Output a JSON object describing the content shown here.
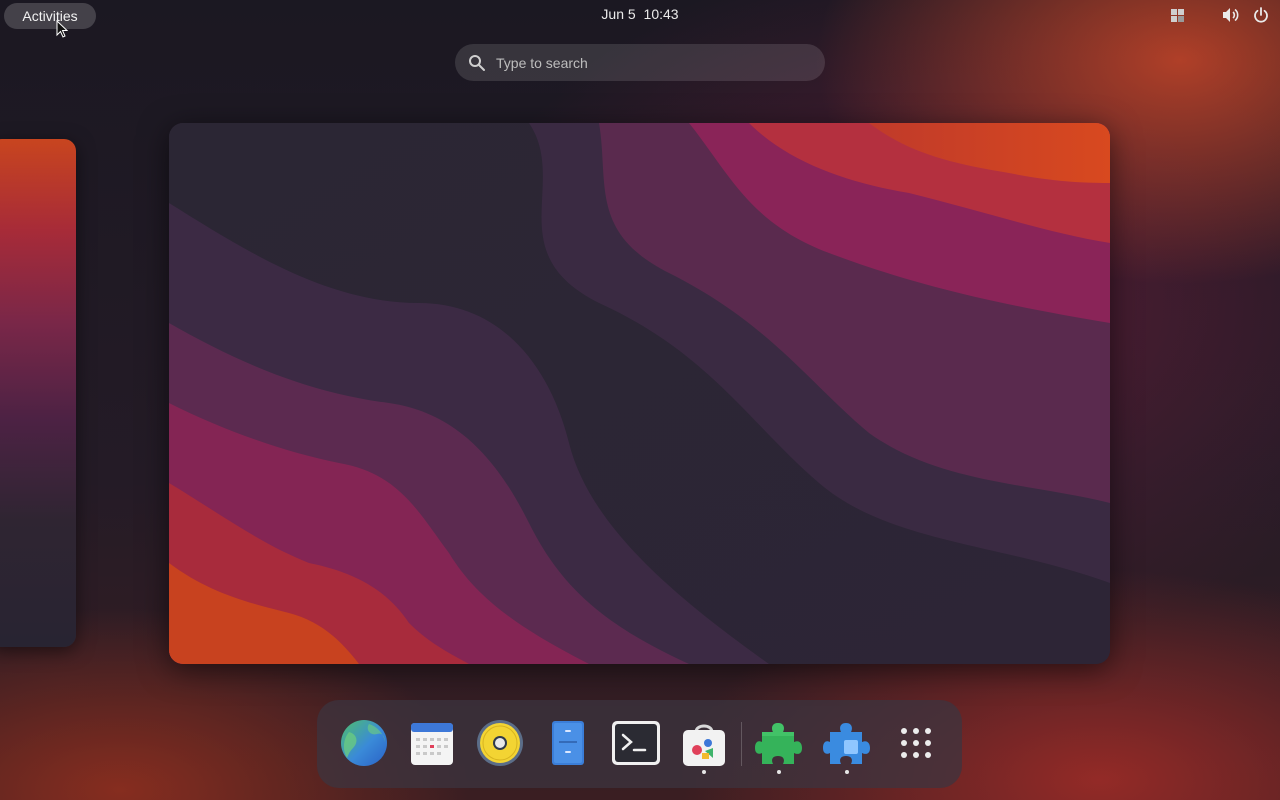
{
  "topbar": {
    "activities_label": "Activities",
    "date": "Jun 5",
    "time": "10:43",
    "tray_icons": [
      "window-layout-icon",
      "volume-icon",
      "power-icon"
    ]
  },
  "search": {
    "placeholder": "Type to search"
  },
  "dock": {
    "apps": [
      {
        "name": "web-browser",
        "icon": "globe-icon",
        "running": false
      },
      {
        "name": "calendar",
        "icon": "calendar-icon",
        "running": false
      },
      {
        "name": "music-player",
        "icon": "speaker-icon",
        "running": false
      },
      {
        "name": "file-manager",
        "icon": "file-cabinet-icon",
        "running": false
      },
      {
        "name": "terminal",
        "icon": "terminal-icon",
        "running": false
      },
      {
        "name": "software-store",
        "icon": "shopping-bag-icon",
        "running": true
      },
      {
        "name": "extensions",
        "icon": "puzzle-green-icon",
        "running": true
      },
      {
        "name": "extension-manager",
        "icon": "puzzle-blue-icon",
        "running": true
      },
      {
        "name": "show-apps",
        "icon": "app-grid-icon",
        "running": false
      }
    ]
  },
  "colors": {
    "accent_orange": "#c8451f",
    "wallpaper_dark": "#2a2434",
    "wallpaper_magenta": "#8a2456"
  }
}
